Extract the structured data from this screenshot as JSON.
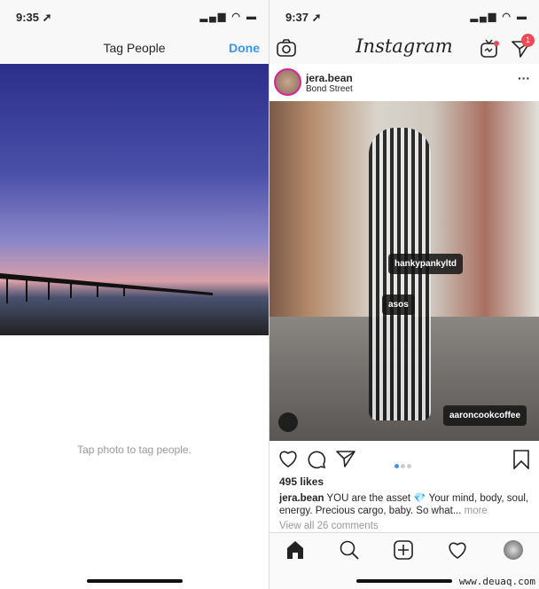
{
  "left": {
    "status": {
      "time": "9:35 ➚"
    },
    "nav": {
      "title": "Tag People",
      "done": "Done"
    },
    "hint": "Tap photo to tag people."
  },
  "right": {
    "status": {
      "time": "9:37 ➚"
    },
    "nav": {
      "logo": "Instagram",
      "dm_badge": "1"
    },
    "post": {
      "username": "jera.bean",
      "location": "Bond Street",
      "more": "···",
      "tags": [
        "hankypankyltd",
        "asos",
        "aaroncookcoffee"
      ],
      "carousel": {
        "count": 3,
        "active": 1
      },
      "likes": "495 likes",
      "caption_user": "jera.bean",
      "caption_text": " YOU are the asset 💎 Your mind, body, soul, energy. Precious cargo, baby. So what... ",
      "caption_more": "more",
      "comments": "View all 26 comments"
    },
    "tabs": [
      "home-icon",
      "search-icon",
      "add-post-icon",
      "heart-icon",
      "profile-avatar"
    ]
  },
  "watermark": "www.deuaq.com",
  "colors": {
    "accent": "#3897f0",
    "badge": "#ed4956"
  }
}
